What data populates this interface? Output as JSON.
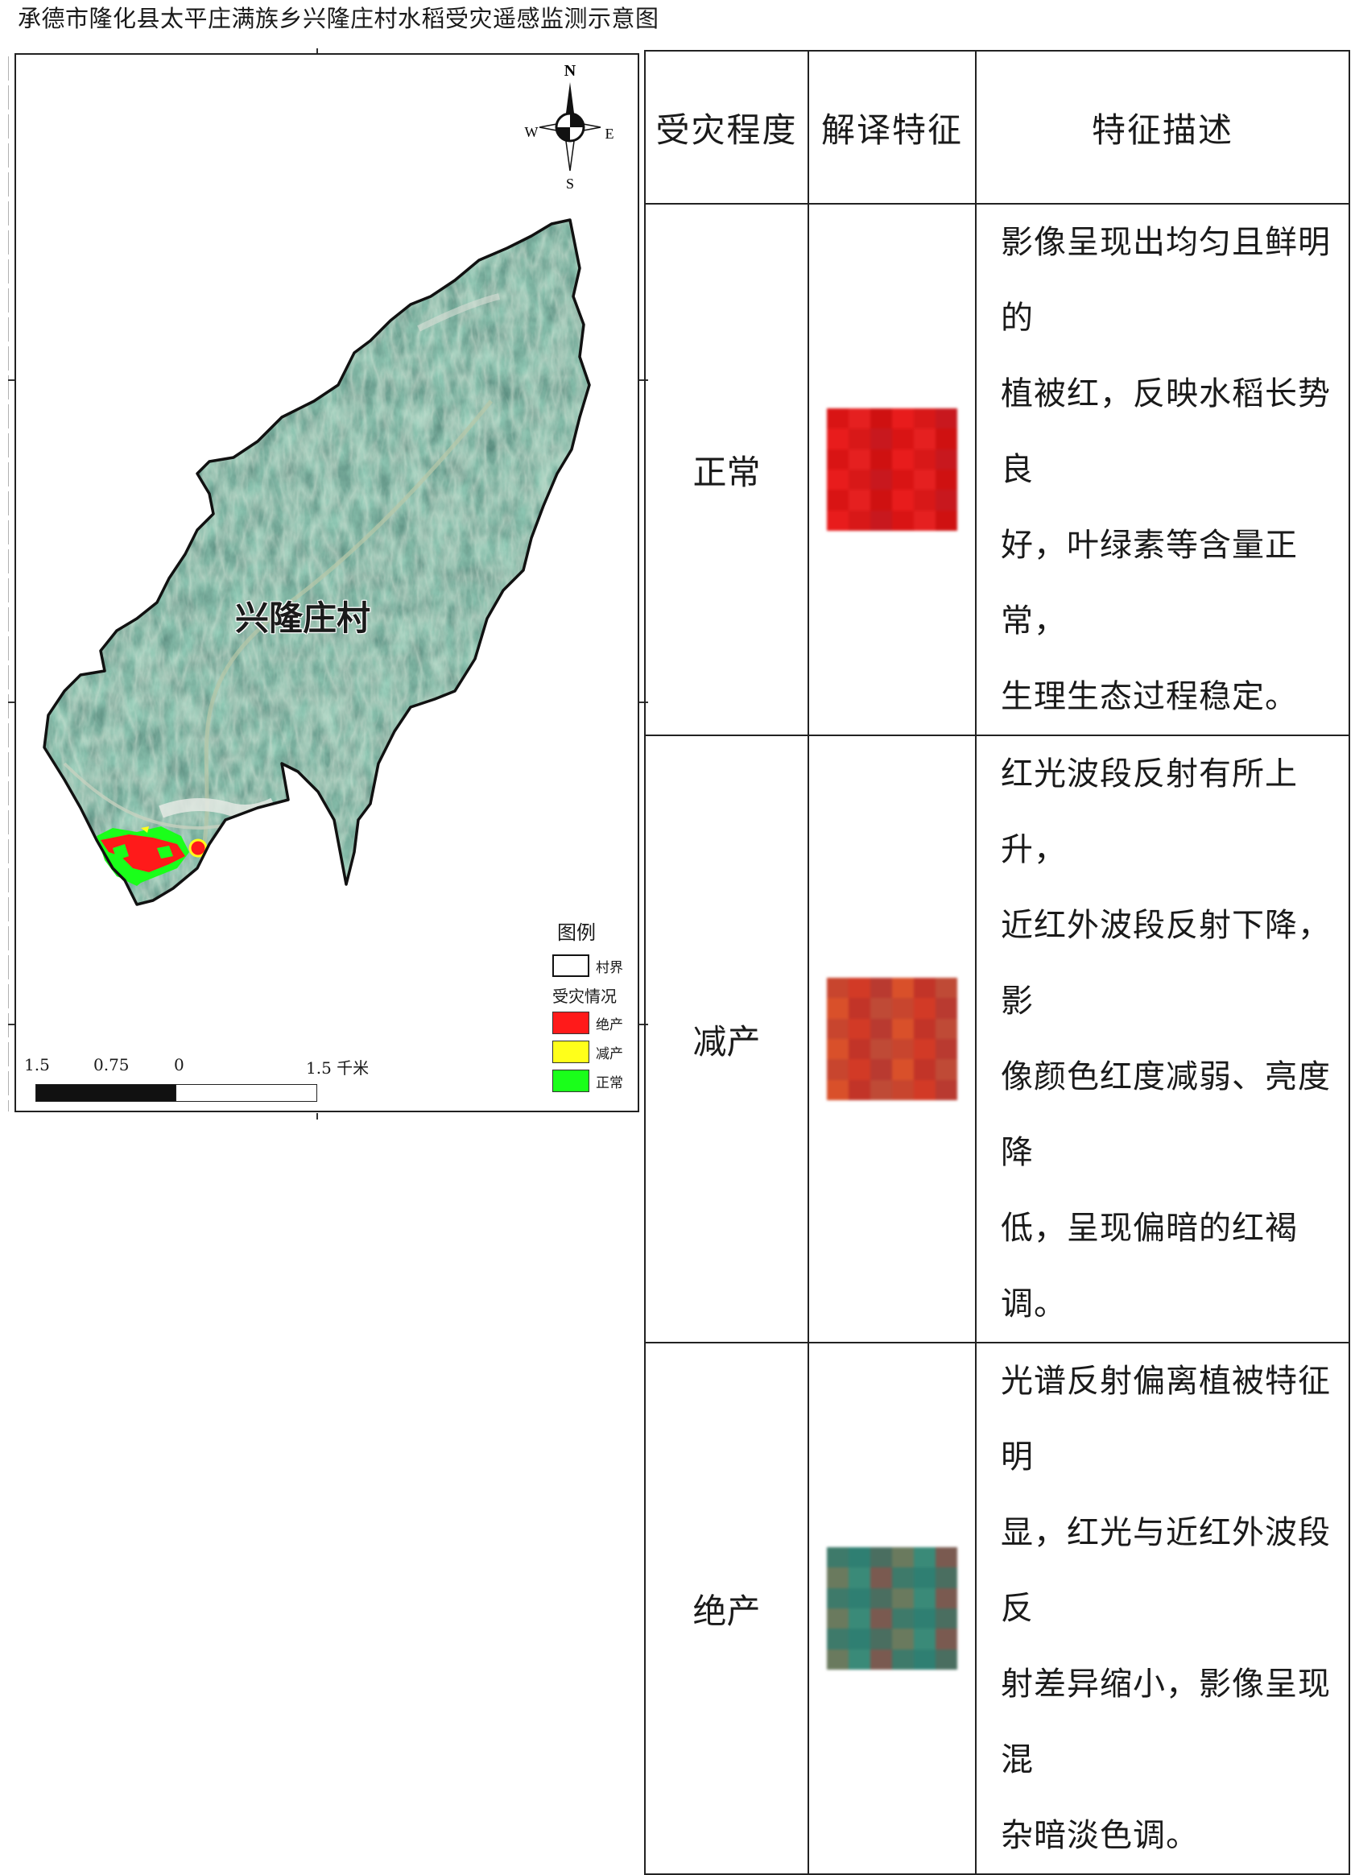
{
  "title": "承德市隆化县太平庄满族乡兴隆庄村水稻受灾遥感监测示意图",
  "map": {
    "village_name": "兴隆庄村",
    "compass": {
      "n": "N",
      "s": "S",
      "e": "E",
      "w": "W"
    },
    "legend": {
      "title": "图例",
      "boundary_label": "村界",
      "damage_title": "受灾情况",
      "items": [
        {
          "label": "绝产",
          "color": "#ff1a1a"
        },
        {
          "label": "减产",
          "color": "#ffff1a"
        },
        {
          "label": "正常",
          "color": "#1aff1a"
        }
      ]
    },
    "scale": {
      "t0": "1.5",
      "t1": "0.75",
      "t2": "0",
      "t3": "1.5 千米"
    }
  },
  "table": {
    "headers": [
      "受灾程度",
      "解译特征",
      "特征描述"
    ],
    "rows": [
      {
        "level": "正常",
        "desc_lines": [
          "影像呈现出均匀且鲜明的",
          "植被红，反映水稻长势良",
          "好，叶绿素等含量正常，",
          "生理生态过程稳定。"
        ],
        "palette": [
          "#d91414",
          "#e52020",
          "#cf1111",
          "#e81c1c",
          "#d81818",
          "#c8181e"
        ]
      },
      {
        "level": "减产",
        "desc_lines": [
          "红光波段反射有所上升，",
          "近红外波段反射下降，影",
          "像颜色红度减弱、亮度降",
          "低，呈现偏暗的红褐调。"
        ],
        "palette": [
          "#c8452e",
          "#d23a26",
          "#b93a30",
          "#d9502a",
          "#c23428",
          "#bf4a36"
        ]
      },
      {
        "level": "绝产",
        "desc_lines": [
          "光谱反射偏离植被特征明",
          "显，红光与近红外波段反",
          "射差异缩小，影像呈现混",
          "杂暗淡色调。"
        ],
        "palette": [
          "#3e7a6a",
          "#2f7f72",
          "#4a6e60",
          "#6a7a5e",
          "#3a8a78",
          "#7a5a50"
        ]
      }
    ]
  }
}
